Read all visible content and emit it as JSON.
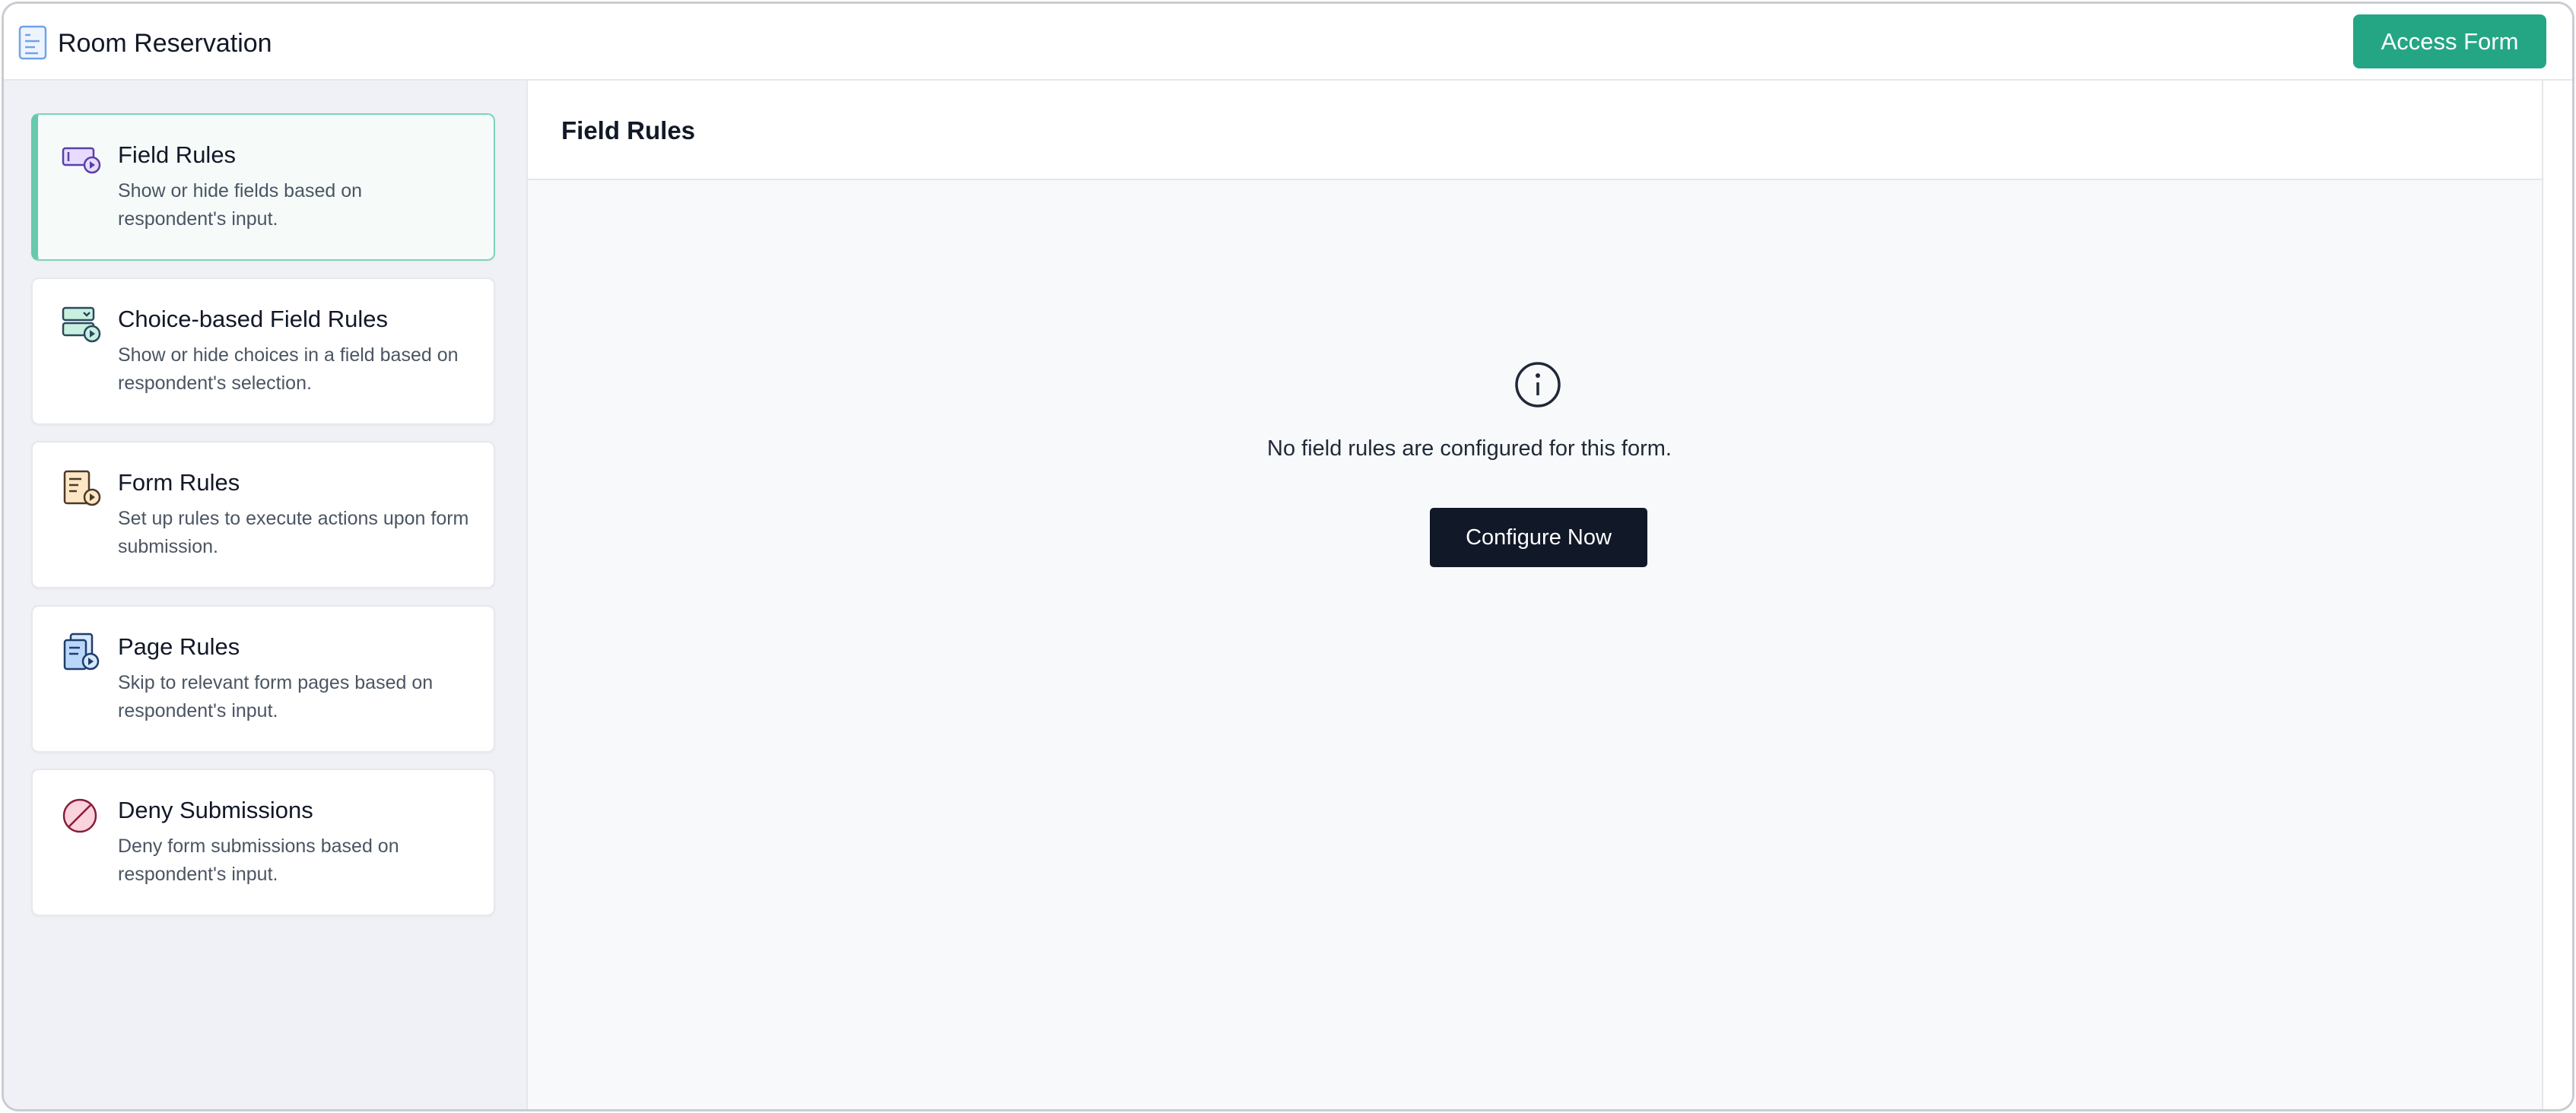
{
  "header": {
    "app_title": "Room Reservation",
    "app_icon": "form-document-icon",
    "access_button": "Access Form",
    "accent_color": "#24a685"
  },
  "sidebar": {
    "items": [
      {
        "title": "Field Rules",
        "description": "Show or hide fields based on respondent's input.",
        "icon": "field-rules-icon",
        "active": true
      },
      {
        "title": "Choice-based Field Rules",
        "description": "Show or hide choices in a field based on respondent's selection.",
        "icon": "choice-rules-icon",
        "active": false
      },
      {
        "title": "Form Rules",
        "description": "Set up rules to execute actions upon form submission.",
        "icon": "form-rules-icon",
        "active": false
      },
      {
        "title": "Page Rules",
        "description": "Skip to relevant form pages based on respondent's input.",
        "icon": "page-rules-icon",
        "active": false
      },
      {
        "title": "Deny Submissions",
        "description": "Deny form submissions based on respondent's input.",
        "icon": "deny-icon",
        "active": false
      }
    ]
  },
  "main": {
    "title": "Field Rules",
    "empty_icon": "info-icon",
    "empty_message": "No field rules are configured for this form.",
    "configure_button": "Configure Now"
  }
}
